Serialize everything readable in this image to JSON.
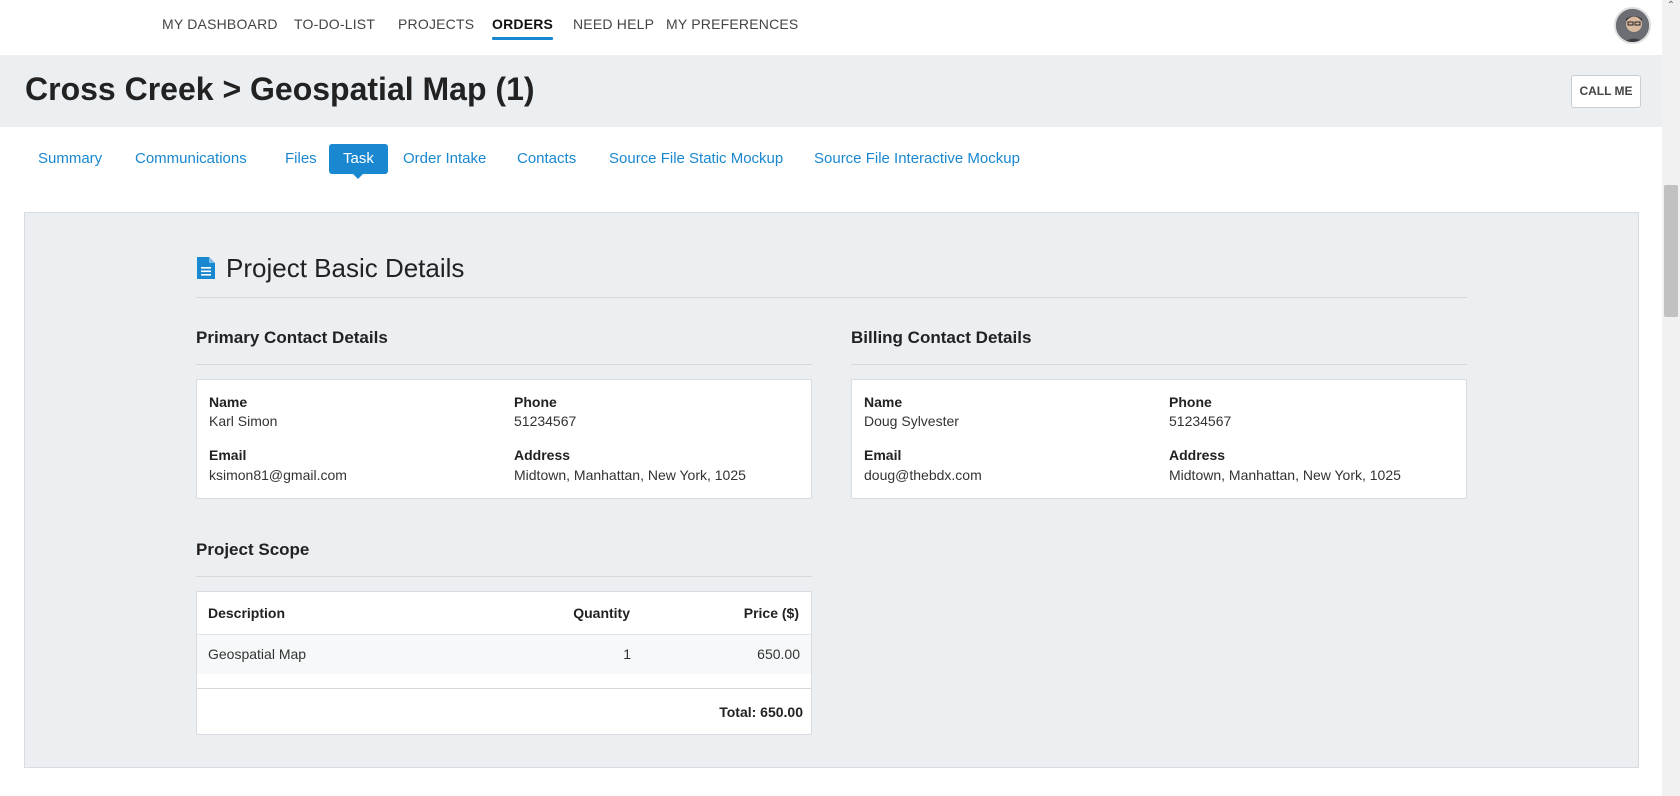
{
  "topnav": {
    "items": [
      "MY DASHBOARD",
      "TO-DO-LIST",
      "PROJECTS",
      "ORDERS",
      "NEED HELP",
      "MY PREFERENCES"
    ],
    "active": "ORDERS"
  },
  "header": {
    "title": "Cross Creek > Geospatial Map (1)",
    "call_me": "CALL ME"
  },
  "tabs": [
    "Summary",
    "Communications",
    "Files",
    "Task",
    "Order Intake",
    "Contacts",
    "Source File Static Mockup",
    "Source File Interactive Mockup"
  ],
  "active_tab": "Task",
  "main": {
    "section_title": "Project Basic Details",
    "primary": {
      "heading": "Primary Contact Details",
      "name_label": "Name",
      "name": "Karl Simon",
      "phone_label": "Phone",
      "phone": "51234567",
      "email_label": "Email",
      "email": "ksimon81@gmail.com",
      "address_label": "Address",
      "address": "Midtown, Manhattan, New York, 1025"
    },
    "billing": {
      "heading": "Billing Contact Details",
      "name_label": "Name",
      "name": "Doug Sylvester",
      "phone_label": "Phone",
      "phone": "51234567",
      "email_label": "Email",
      "email": "doug@thebdx.com",
      "address_label": "Address",
      "address": "Midtown, Manhattan, New York, 1025"
    },
    "scope": {
      "heading": "Project Scope",
      "columns": [
        "Description",
        "Quantity",
        "Price ($)"
      ],
      "rows": [
        {
          "description": "Geospatial Map",
          "quantity": "1",
          "price": "650.00"
        }
      ],
      "total": "Total: 650.00"
    }
  },
  "colors": {
    "accent": "#1a88d0",
    "panel_bg": "#eceff2"
  }
}
